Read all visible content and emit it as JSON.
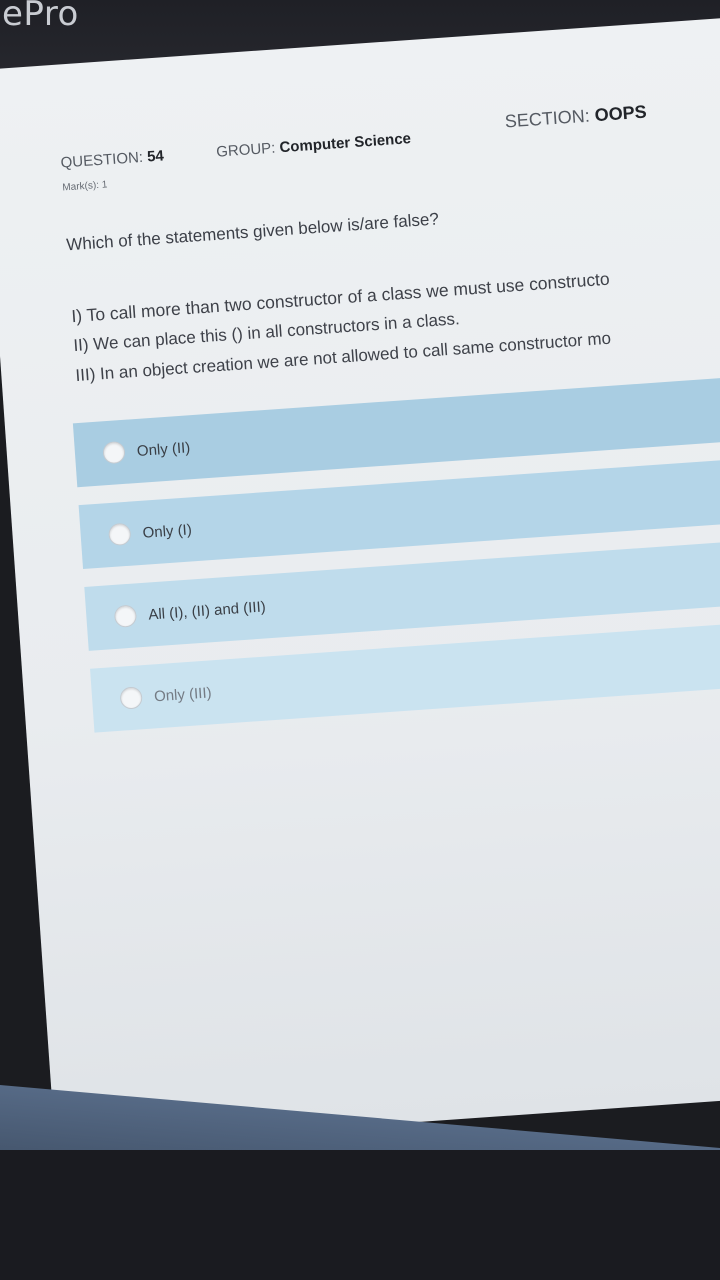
{
  "app": {
    "title": "ePro"
  },
  "meta": {
    "question_label": "QUESTION:",
    "question_number": "54",
    "group_label": "GROUP:",
    "group_value": "Computer Science",
    "section_label": "SECTION:",
    "section_value": "OOPS",
    "marks_label": "Mark(s):",
    "marks_value": "1"
  },
  "question": {
    "text": "Which of the statements given below is/are false?",
    "statements": [
      "I) To call more than two constructor of a class we must use constructo",
      "II) We can place this () in all constructors in a class.",
      "III) In an object creation we are not allowed to call same constructor mo"
    ]
  },
  "options": [
    {
      "label": "Only (II)"
    },
    {
      "label": "Only (I)"
    },
    {
      "label": "All (I), (II) and (III)"
    },
    {
      "label": "Only (III)"
    }
  ],
  "colors": {
    "option_bg": "#a9cde2",
    "page_bg": "#eef1f3",
    "top_bar": "#1f2026"
  }
}
